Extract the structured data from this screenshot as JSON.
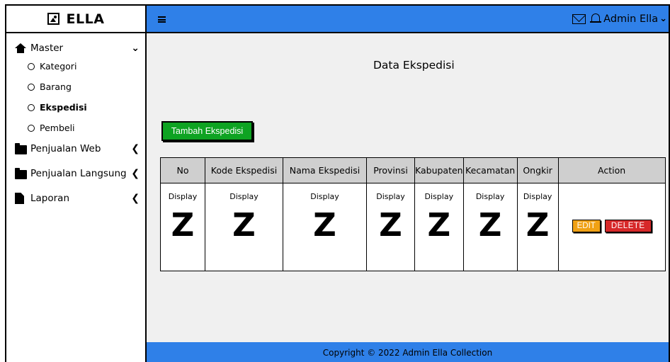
{
  "app": {
    "brand": "ELLA"
  },
  "sidebar": {
    "groups": [
      {
        "label": "Master",
        "icon": "home-icon",
        "chevron": "down"
      },
      {
        "label": "Penjualan Web",
        "icon": "folder-icon",
        "chevron": "left"
      },
      {
        "label": "Penjualan Langsung",
        "icon": "folder-icon",
        "chevron": "left"
      },
      {
        "label": "Laporan",
        "icon": "file-icon",
        "chevron": "left"
      }
    ],
    "master_items": [
      {
        "label": "Kategori",
        "active": false
      },
      {
        "label": "Barang",
        "active": false
      },
      {
        "label": "Ekspedisi",
        "active": true
      },
      {
        "label": "Pembeli",
        "active": false
      }
    ]
  },
  "topbar": {
    "user_label": "Admin Ella",
    "menu_icon": "hamburger-icon",
    "mail_icon": "envelope-icon",
    "notify_icon": "bell-icon"
  },
  "page": {
    "title": "Data Ekspedisi",
    "add_button": "Tambah Ekspedisi"
  },
  "table": {
    "columns": [
      "No",
      "Kode Ekspedisi",
      "Nama Ekspedisi",
      "Provinsi",
      "Kabupaten",
      "Kecamatan",
      "Ongkir",
      "Action"
    ],
    "row": {
      "display_label": "Display",
      "glyph": "Z",
      "edit_label": "EDIT",
      "delete_label": "DELETE"
    }
  },
  "footer": {
    "text": "Copyright © 2022 Admin Ella Collection"
  },
  "colors": {
    "topbar": "#2f80e8",
    "add_button": "#0ea322",
    "edit_button": "#f0a114",
    "delete_button": "#d72829",
    "header_cell": "#cfcfcf",
    "content_bg": "#f0f0f0"
  }
}
